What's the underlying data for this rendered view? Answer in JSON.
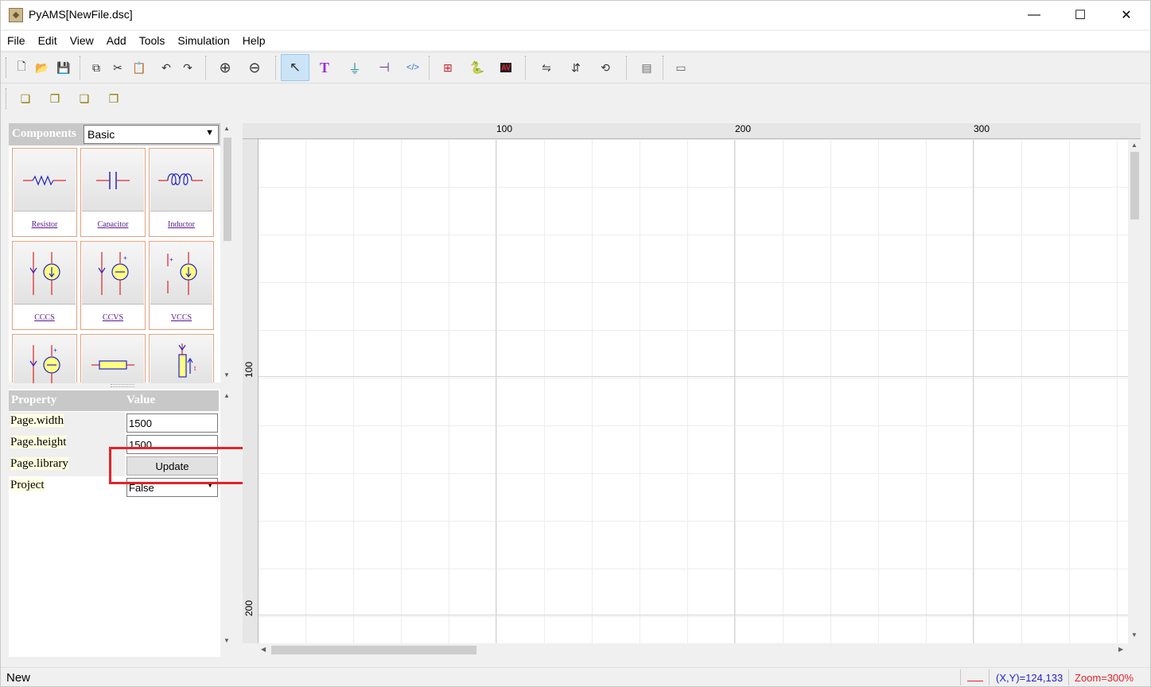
{
  "window": {
    "title": "PyAMS[NewFile.dsc]",
    "controls": [
      "—",
      "☐",
      "✕"
    ]
  },
  "menu": [
    "File",
    "Edit",
    "View",
    "Add",
    "Tools",
    "Simulation",
    "Help"
  ],
  "toolbar1": [
    {
      "icon": "new-file-icon",
      "glyph": "🗋"
    },
    {
      "icon": "open-folder-icon",
      "glyph": "📂"
    },
    {
      "icon": "save-icon",
      "glyph": "💾"
    },
    {
      "icon": "copy-icon",
      "glyph": "⧉"
    },
    {
      "icon": "cut-icon",
      "glyph": "✂"
    },
    {
      "icon": "paste-icon",
      "glyph": "📋"
    },
    {
      "icon": "undo-icon",
      "glyph": "↶"
    },
    {
      "icon": "redo-icon",
      "glyph": "↷"
    },
    {
      "icon": "zoom-in-icon",
      "glyph": "⊕"
    },
    {
      "icon": "zoom-out-icon",
      "glyph": "⊖"
    },
    {
      "icon": "select-pointer-icon",
      "glyph": "↖"
    },
    {
      "icon": "text-tool-icon",
      "glyph": "T"
    },
    {
      "icon": "ground-icon",
      "glyph": "⏚"
    },
    {
      "icon": "net-label-icon",
      "glyph": "⊣"
    },
    {
      "icon": "code-icon",
      "glyph": "</>"
    },
    {
      "icon": "add-probe-icon",
      "glyph": "⊞"
    },
    {
      "icon": "python-icon",
      "glyph": "🐍"
    },
    {
      "icon": "voltmeter-icon",
      "glyph": "AV"
    },
    {
      "icon": "flip-horizontal-icon",
      "glyph": "⇋"
    },
    {
      "icon": "flip-vertical-icon",
      "glyph": "⇵"
    },
    {
      "icon": "rotate-icon",
      "glyph": "⟲"
    },
    {
      "icon": "run-analysis-icon",
      "glyph": "▤"
    },
    {
      "icon": "options-icon",
      "glyph": "▭"
    }
  ],
  "toolbar2": [
    {
      "icon": "bring-to-front-icon",
      "glyph": "❏"
    },
    {
      "icon": "send-to-back-icon",
      "glyph": "❐"
    },
    {
      "icon": "bring-forward-icon",
      "glyph": "❑"
    },
    {
      "icon": "send-backward-icon",
      "glyph": "❒"
    }
  ],
  "components": {
    "title": "Components",
    "library": "Basic",
    "items": [
      {
        "name": "Resistor"
      },
      {
        "name": "Capacitor"
      },
      {
        "name": "Inductor"
      },
      {
        "name": "CCCS"
      },
      {
        "name": "CCVS"
      },
      {
        "name": "VCCS"
      },
      {
        "name": ""
      },
      {
        "name": ""
      },
      {
        "name": ""
      }
    ]
  },
  "properties": {
    "col_property": "Property",
    "col_value": "Value",
    "rows": [
      {
        "key": "Page.width",
        "value": "1500"
      },
      {
        "key": "Page.height",
        "value": "1500"
      },
      {
        "key": "Page.library",
        "value": "Update"
      },
      {
        "key": "Project",
        "value": "False"
      }
    ]
  },
  "ruler": {
    "h_labels": [
      "100",
      "200",
      "300"
    ],
    "v_labels": [
      "100",
      "200"
    ]
  },
  "status": {
    "message": "New",
    "coords": "(X,Y)=124,133",
    "zoom": "Zoom=300%"
  },
  "colors": {
    "highlight": "#e5222a",
    "coords_text": "#2222cc",
    "zoom_text": "#e5222a",
    "component_border": "#e0a080"
  }
}
